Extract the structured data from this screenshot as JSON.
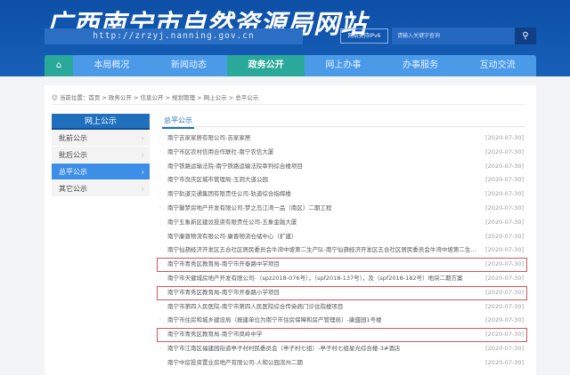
{
  "header": {
    "title": "广西南宁市自然资源局网站",
    "url": "http://zrzyj.nanning.gov.cn",
    "ipv6": "网站支持IPv6",
    "search_placeholder": "请输入关键字查询",
    "search_icon": "search-icon"
  },
  "nav": {
    "home_icon": "home-icon",
    "items": [
      "本局概况",
      "新闻动态",
      "政务公开",
      "网上办事",
      "办事服务",
      "互动交流"
    ],
    "active": "政务公开"
  },
  "breadcrumb": "当前位置：首页 > 政务公开 > 信息公开 > 规划管理 > 网上公示 > 总平公示",
  "sidebar": {
    "title": "网上公示",
    "items": [
      {
        "label": "批前公示",
        "active": false
      },
      {
        "label": "批后公示",
        "active": false
      },
      {
        "label": "总平公示",
        "active": true
      },
      {
        "label": "其它公示",
        "active": false
      }
    ]
  },
  "content": {
    "tab": "总平公示",
    "rows": [
      {
        "text": "南宁吉家家居有限公司-吉家家居",
        "date": "[2020-07-30]",
        "highlight": false
      },
      {
        "text": "南宁市区农村信用合作联社-南宁农信大厦",
        "date": "[2020-07-30]",
        "highlight": false
      },
      {
        "text": "南宁铁路运输法院-南宁铁路运输法院审判综合楼项目",
        "date": "[2020-07-30]",
        "highlight": false
      },
      {
        "text": "南宁市良庆区城市管理局-玉洞大道公园",
        "date": "[2020-07-30]",
        "highlight": false
      },
      {
        "text": "南宁轨道交通集团有限责任公司-轨道综合指挥楼",
        "date": "[2020-07-30]",
        "highlight": false
      },
      {
        "text": "南宁馨梦房地产开发有限公司-梦之岛江湾一品（南区）二期工程",
        "date": "[2020-07-30]",
        "highlight": false
      },
      {
        "text": "南宁五象新区建设投资有限责任公司-五象金融大厦",
        "date": "[2020-07-30]",
        "highlight": false
      },
      {
        "text": "南宁康晋物流有限公司-康晋物流仓储中心（扩建）",
        "date": "[2020-07-30]",
        "highlight": false
      },
      {
        "text": "南宁仙葫经济开发区五合社区居民委员会牛湾中坡第二生产队-南宁仙葫经济开发区五合社区居民委员会牛湾中坡第二生...",
        "date": "[2020-07-30]",
        "highlight": false
      },
      {
        "text": "南宁市青秀区教育局-南宁市开泰路中学项目",
        "date": "[2020-07-30]",
        "highlight": true
      },
      {
        "text": "南宁市天健城房地产开发有限公司-（spz2018-076号），（spf2018-137号），及（spf2018-182号）地块二期方案",
        "date": "[2020-07-30]",
        "highlight": false
      },
      {
        "text": "南宁市青秀区教育局-南宁市开泰路小学项目",
        "date": "[2020-07-30]",
        "highlight": true
      },
      {
        "text": "南宁市第四人民医院-南宁市第四人民医院综合传染病门诊住院楼项目",
        "date": "[2020-07-30]",
        "highlight": false
      },
      {
        "text": "南宁市住房和城乡建设局（报建单位为南宁市住房保障和房产管理局）-康盛园1号楼",
        "date": "[2020-07-30]",
        "highlight": false
      },
      {
        "text": "南宁市青秀区教育局-南宁市凤岭中学",
        "date": "[2020-07-30]",
        "highlight": true
      },
      {
        "text": "南宁市江南区福建园街道亭子村村民委员会（亭子村七组）-亭子村七组星光综合楼-3#酒店",
        "date": "[2020-07-30]",
        "highlight": false
      },
      {
        "text": "南宁中房投资置业房地产有限公司-人和公园滨州二期",
        "date": "[2020-07-30]",
        "highlight": false
      }
    ]
  },
  "colors": {
    "header": "#1760b8",
    "nav": "#4a9ae8",
    "active": "#2aa89a",
    "highlight": "#d2555f"
  }
}
